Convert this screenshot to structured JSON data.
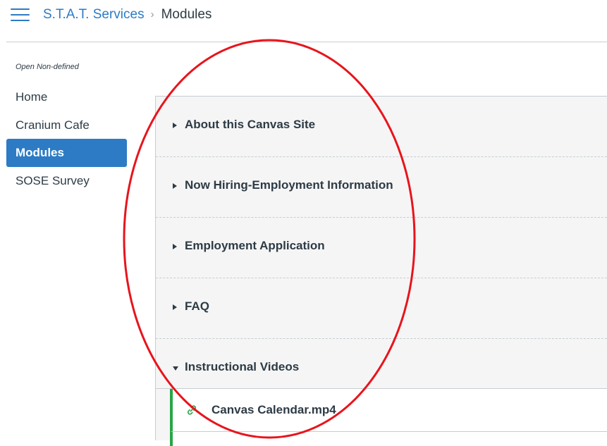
{
  "header": {
    "menu_icon": "hamburger-menu-icon",
    "breadcrumb": {
      "course": "S.T.A.T. Services",
      "separator": "›",
      "current": "Modules"
    }
  },
  "sidebar": {
    "course_status": "Open Non-defined",
    "items": [
      {
        "label": "Home",
        "active": false
      },
      {
        "label": "Cranium Cafe",
        "active": false
      },
      {
        "label": "Modules",
        "active": true
      },
      {
        "label": "SOSE Survey",
        "active": false
      }
    ]
  },
  "modules": [
    {
      "title": "About this Canvas Site",
      "expanded": false
    },
    {
      "title": "Now Hiring-Employment Information",
      "expanded": false
    },
    {
      "title": "Employment Application",
      "expanded": false
    },
    {
      "title": "FAQ",
      "expanded": false
    },
    {
      "title": "Instructional Videos",
      "expanded": true,
      "items": [
        {
          "title": "Canvas Calendar.mp4",
          "icon": "link-icon"
        }
      ]
    }
  ],
  "colors": {
    "accent": "#2d7bc4",
    "text": "#2d3b45",
    "module_bg": "#f5f5f5",
    "published_bar": "#27a645",
    "annotation": "#e8141c"
  }
}
